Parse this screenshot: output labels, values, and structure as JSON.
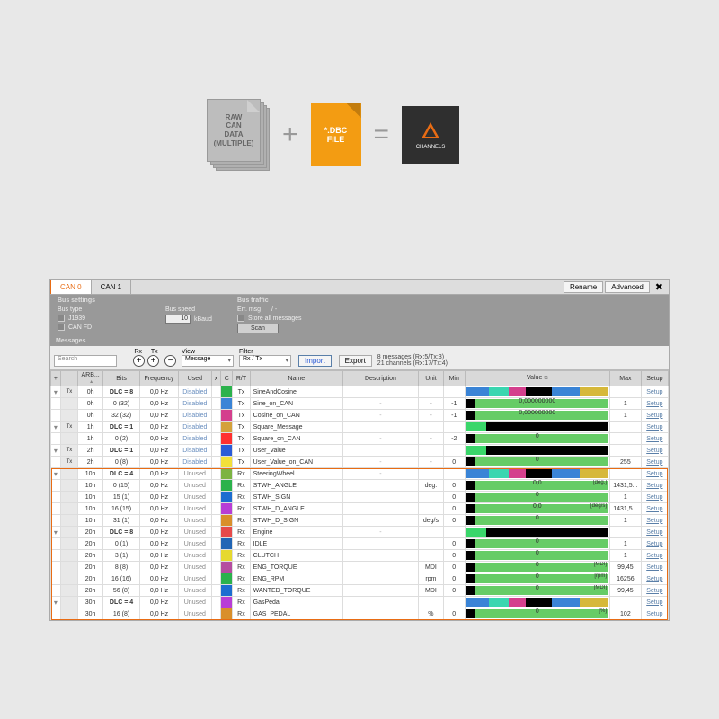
{
  "diagram": {
    "raw": "RAW\nCAN\nDATA\n(MULTIPLE)",
    "dbc": "*.DBC\nFILE",
    "channels": "CHANNELS"
  },
  "tabs": {
    "active": "CAN 0",
    "inactive": "CAN 1",
    "rename": "Rename",
    "advanced": "Advanced"
  },
  "toolbar1": {
    "bus_settings": "Bus settings",
    "bus_type": "Bus type",
    "j1939": "J1939",
    "canfd": "CAN FD",
    "bus_speed": "Bus speed",
    "speed_val": "10",
    "kbaud": "kBaud",
    "bus_traffic": "Bus traffic",
    "err_msg": "Err. msg",
    "err_val": "/ -",
    "store": "Store all messages",
    "scan": "Scan"
  },
  "toolbar2": {
    "messages_hdr": "Messages",
    "search": "Search",
    "rx": "Rx",
    "tx": "Tx",
    "view": "View",
    "view_val": "Message",
    "filter": "Filter",
    "filter_val": "Rx / Tx",
    "import": "Import",
    "export": "Export",
    "counts1": "8 messages (Rx:5/Tx:3)",
    "counts2": "21 channels (Rx:17/Tx:4)"
  },
  "headers": {
    "plus": "+",
    "arb": "ARB...",
    "bits": "Bits",
    "freq": "Frequency",
    "used": "Used",
    "x": "x",
    "c": "C",
    "rt": "R/T",
    "name": "Name",
    "desc": "Description",
    "unit": "Unit",
    "min": "Min",
    "value": "Value",
    "max": "Max",
    "setup": "Setup"
  },
  "rows": [
    {
      "type": "msg",
      "tr": "Tx",
      "arb": "0h",
      "dlc": "DLC = 8",
      "freq": "0,0 Hz",
      "used": "Disabled",
      "c": "#2bb24c",
      "rt": "Tx",
      "name": "SineAndCosine",
      "desc": "",
      "unit": "",
      "min": "",
      "val": "bar-multi",
      "max": "",
      "setup": "Setup"
    },
    {
      "type": "ch",
      "tr": "",
      "arb": "0h",
      "dlc": "0 (32)",
      "freq": "0,0 Hz",
      "used": "Disabled",
      "c": "#3a84d6",
      "rt": "Tx",
      "name": "Sine_on_CAN",
      "desc": "-",
      "unit": "-",
      "min": "-1",
      "val": "0,000000000",
      "vfmt": "light",
      "max": "1",
      "setup": "Setup"
    },
    {
      "type": "ch",
      "tr": "",
      "arb": "0h",
      "dlc": "32 (32)",
      "freq": "0,0 Hz",
      "used": "Disabled",
      "c": "#d43f8d",
      "rt": "Tx",
      "name": "Cosine_on_CAN",
      "desc": "-",
      "unit": "-",
      "min": "-1",
      "val": "0,000000000",
      "vfmt": "light",
      "max": "1",
      "setup": "Setup"
    },
    {
      "type": "msg",
      "tr": "Tx",
      "arb": "1h",
      "dlc": "DLC = 1",
      "freq": "0,0 Hz",
      "used": "Disabled",
      "c": "#d4a13a",
      "rt": "Tx",
      "name": "Square_Message",
      "desc": "",
      "unit": "",
      "min": "",
      "val": "bar-black",
      "max": "",
      "setup": "Setup"
    },
    {
      "type": "ch",
      "tr": "",
      "arb": "1h",
      "dlc": "0 (2)",
      "freq": "0,0 Hz",
      "used": "Disabled",
      "c": "#ff3030",
      "rt": "Tx",
      "name": "Square_on_CAN",
      "desc": "-",
      "unit": "-",
      "min": "-2",
      "val": "0",
      "vfmt": "light",
      "max": "",
      "setup": "Setup"
    },
    {
      "type": "msg",
      "tr": "Tx",
      "arb": "2h",
      "dlc": "DLC = 1",
      "freq": "0,0 Hz",
      "used": "Disabled",
      "c": "#2a5bd7",
      "rt": "Tx",
      "name": "User_Value",
      "desc": "",
      "unit": "",
      "min": "",
      "val": "bar-black",
      "max": "",
      "setup": "Setup"
    },
    {
      "type": "ch",
      "tr": "Tx",
      "arb": "2h",
      "dlc": "0 (8)",
      "freq": "0,0 Hz",
      "used": "Disabled",
      "c": "#f2e03a",
      "rt": "Tx",
      "name": "User_Value_on_CAN",
      "desc": "-",
      "unit": "-",
      "min": "0",
      "val": "0",
      "vfmt": "light",
      "max": "255",
      "setup": "Setup"
    },
    {
      "type": "msg",
      "tr": "",
      "arb": "10h",
      "dlc": "DLC = 4",
      "freq": "0,0 Hz",
      "used": "Unused",
      "c": "#7cb342",
      "rt": "Rx",
      "name": "SteeringWheel",
      "desc": "-",
      "unit": "",
      "min": "",
      "val": "bar-multi",
      "max": "",
      "setup": "Setup",
      "hl": true
    },
    {
      "type": "ch",
      "tr": "",
      "arb": "10h",
      "dlc": "0 (15)",
      "freq": "0,0 Hz",
      "used": "Unused",
      "c": "#2bb24c",
      "rt": "Rx",
      "name": "STWH_ANGLE",
      "desc": "",
      "unit": "deg.",
      "min": "0",
      "val": "0,0",
      "vfmt": "light",
      "max": "1431,5...",
      "umax": "[deg.]",
      "setup": "Setup",
      "hl": true
    },
    {
      "type": "ch",
      "tr": "",
      "arb": "10h",
      "dlc": "15 (1)",
      "freq": "0,0 Hz",
      "used": "Unused",
      "c": "#1c6dd0",
      "rt": "Rx",
      "name": "STWH_SIGN",
      "desc": "",
      "unit": "",
      "min": "0",
      "val": "0",
      "vfmt": "light",
      "max": "1",
      "setup": "Setup",
      "hl": true
    },
    {
      "type": "ch",
      "tr": "",
      "arb": "10h",
      "dlc": "16 (15)",
      "freq": "0,0 Hz",
      "used": "Unused",
      "c": "#b83dd6",
      "rt": "Rx",
      "name": "STWH_D_ANGLE",
      "desc": "",
      "unit": "",
      "min": "0",
      "val": "0,0",
      "vfmt": "light",
      "max": "1431,5...",
      "umax": "[deg/s]",
      "setup": "Setup",
      "hl": true
    },
    {
      "type": "ch",
      "tr": "",
      "arb": "10h",
      "dlc": "31 (1)",
      "freq": "0,0 Hz",
      "used": "Unused",
      "c": "#d98f2b",
      "rt": "Rx",
      "name": "STWH_D_SIGN",
      "desc": "",
      "unit": "deg/s",
      "min": "0",
      "val": "0",
      "vfmt": "light",
      "max": "1",
      "setup": "Setup",
      "hl": true
    },
    {
      "type": "msg",
      "tr": "",
      "arb": "20h",
      "dlc": "DLC = 8",
      "freq": "0,0 Hz",
      "used": "Unused",
      "c": "#e64a4a",
      "rt": "Rx",
      "name": "Engine",
      "desc": "-",
      "unit": "",
      "min": "",
      "val": "bar-black",
      "max": "",
      "setup": "Setup",
      "hl": true
    },
    {
      "type": "ch",
      "tr": "",
      "arb": "20h",
      "dlc": "0 (1)",
      "freq": "0,0 Hz",
      "used": "Unused",
      "c": "#2165b5",
      "rt": "Rx",
      "name": "IDLE",
      "desc": "",
      "unit": "",
      "min": "0",
      "val": "0",
      "vfmt": "light",
      "max": "1",
      "setup": "Setup",
      "hl": true
    },
    {
      "type": "ch",
      "tr": "",
      "arb": "20h",
      "dlc": "3 (1)",
      "freq": "0,0 Hz",
      "used": "Unused",
      "c": "#e6d92f",
      "rt": "Rx",
      "name": "CLUTCH",
      "desc": "",
      "unit": "",
      "min": "0",
      "val": "0",
      "vfmt": "light",
      "max": "1",
      "setup": "Setup",
      "hl": true
    },
    {
      "type": "ch",
      "tr": "",
      "arb": "20h",
      "dlc": "8 (8)",
      "freq": "0,0 Hz",
      "used": "Unused",
      "c": "#b54da0",
      "rt": "Rx",
      "name": "ENG_TORQUE",
      "desc": "",
      "unit": "MDI",
      "min": "0",
      "val": "0",
      "vfmt": "light",
      "max": "99,45",
      "umax": "[MDI]",
      "setup": "Setup",
      "hl": true
    },
    {
      "type": "ch",
      "tr": "",
      "arb": "20h",
      "dlc": "16 (16)",
      "freq": "0,0 Hz",
      "used": "Unused",
      "c": "#2bb24c",
      "rt": "Rx",
      "name": "ENG_RPM",
      "desc": "",
      "unit": "rpm",
      "min": "0",
      "val": "0",
      "vfmt": "light",
      "max": "16256",
      "umax": "[rpm]",
      "setup": "Setup",
      "hl": true
    },
    {
      "type": "ch",
      "tr": "",
      "arb": "20h",
      "dlc": "56 (8)",
      "freq": "0,0 Hz",
      "used": "Unused",
      "c": "#1c6dd0",
      "rt": "Rx",
      "name": "WANTED_TORQUE",
      "desc": "",
      "unit": "MDI",
      "min": "0",
      "val": "0",
      "vfmt": "light",
      "max": "99,45",
      "umax": "[MDI]",
      "setup": "Setup",
      "hl": true
    },
    {
      "type": "msg",
      "tr": "",
      "arb": "30h",
      "dlc": "DLC = 4",
      "freq": "0,0 Hz",
      "used": "Unused",
      "c": "#b83dd6",
      "rt": "Rx",
      "name": "GasPedal",
      "desc": "",
      "unit": "",
      "min": "",
      "val": "bar-multi",
      "max": "",
      "setup": "Setup",
      "hl": true
    },
    {
      "type": "ch",
      "tr": "",
      "arb": "30h",
      "dlc": "16 (8)",
      "freq": "0,0 Hz",
      "used": "Unused",
      "c": "#d98f2b",
      "rt": "Rx",
      "name": "GAS_PEDAL",
      "desc": "",
      "unit": "%",
      "min": "0",
      "val": "0",
      "vfmt": "light",
      "max": "102",
      "umax": "[%]",
      "setup": "Setup",
      "hl": true
    }
  ]
}
